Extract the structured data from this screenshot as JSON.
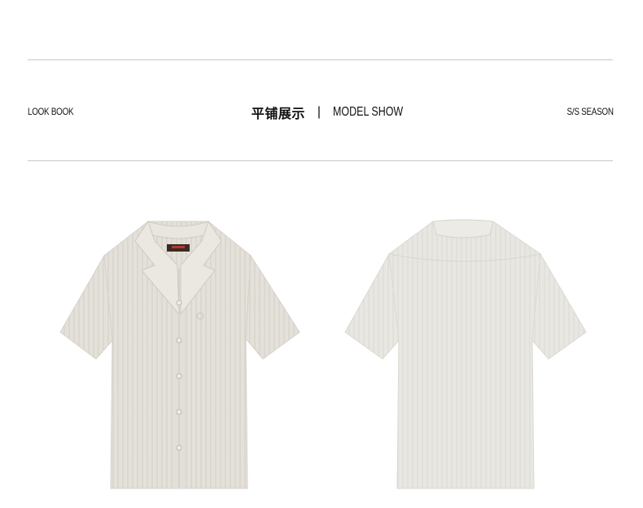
{
  "header": {
    "left_label": "LOOK BOOK",
    "title_cn": "平铺展示",
    "separator": "|",
    "title_en": "MODEL SHOW",
    "right_label": "S/S SEASON"
  },
  "products": {
    "front_view": {
      "icon": "shirt-front-image",
      "color": "#e3e0d9"
    },
    "back_view": {
      "icon": "shirt-back-image",
      "color": "#e8e6e1"
    }
  }
}
